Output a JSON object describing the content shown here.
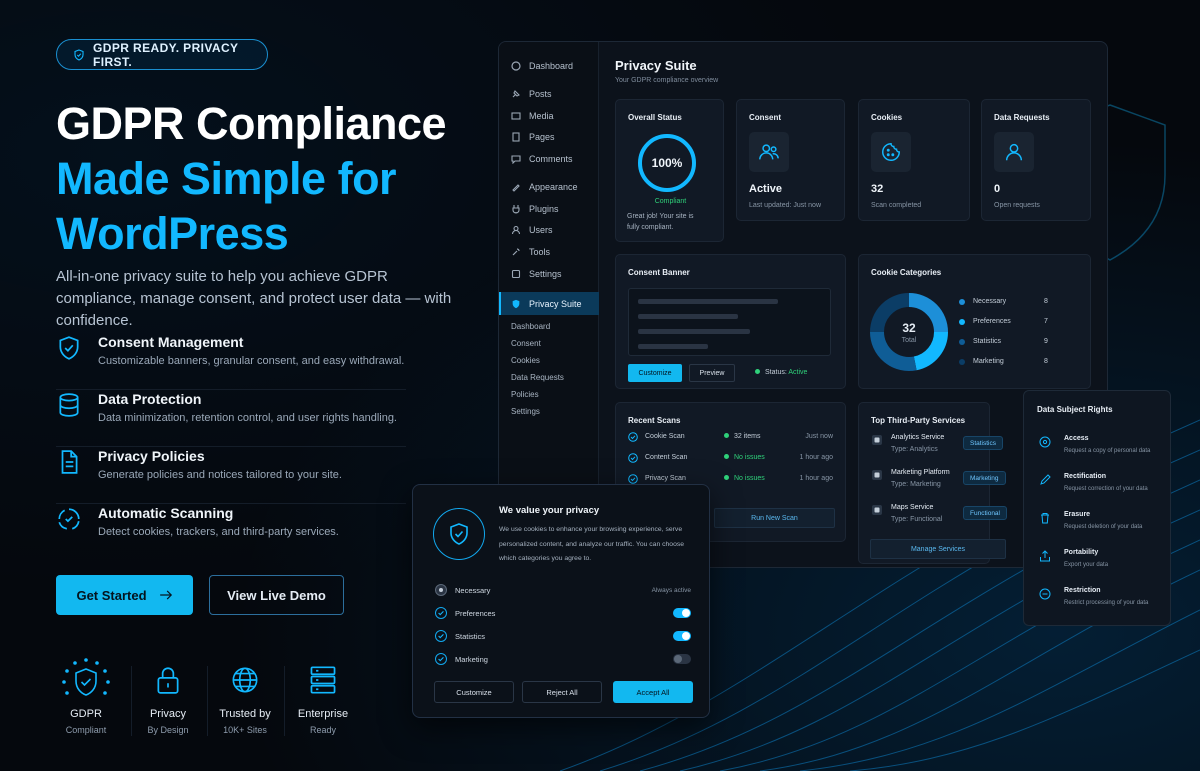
{
  "hero": {
    "badge": "GDPR READY. PRIVACY FIRST.",
    "title_line1": "GDPR Compliance",
    "title_line2": "Made Simple for",
    "title_line3": "WordPress",
    "lead": "All-in-one privacy suite to help you achieve GDPR compliance, manage consent, and protect user data — with confidence.",
    "features": [
      {
        "title": "Consent Management",
        "desc": "Customizable banners, granular consent, and easy withdrawal."
      },
      {
        "title": "Data Protection",
        "desc": "Data minimization, retention control, and user rights handling."
      },
      {
        "title": "Privacy Policies",
        "desc": "Generate policies and notices tailored to your site."
      },
      {
        "title": "Automatic Scanning",
        "desc": "Detect cookies, trackers, and third-party services."
      }
    ],
    "cta_primary": "Get Started",
    "cta_secondary": "View Live Demo",
    "badges": [
      {
        "l1": "GDPR",
        "l2": "Compliant"
      },
      {
        "l1": "Privacy",
        "l2": "By Design"
      },
      {
        "l1": "Trusted by",
        "l2": "10K+ Sites"
      },
      {
        "l1": "Enterprise",
        "l2": "Ready"
      }
    ]
  },
  "sidebar": {
    "items": [
      "Dashboard",
      "Posts",
      "Media",
      "Pages",
      "Comments",
      "Appearance",
      "Plugins",
      "Users",
      "Tools",
      "Settings"
    ],
    "active": "Privacy Suite",
    "sub": [
      "Dashboard",
      "Consent",
      "Cookies",
      "Data Requests",
      "Policies",
      "Settings"
    ]
  },
  "dashboard": {
    "title": "Privacy Suite",
    "subtitle": "Your GDPR compliance overview",
    "overall": {
      "title": "Overall Status",
      "percent": "100%",
      "percent_value": 100,
      "status": "Compliant",
      "note": "Great job! Your site is fully compliant."
    },
    "consent": {
      "title": "Consent",
      "value": "Active",
      "note": "Last updated: Just now"
    },
    "cookies": {
      "title": "Cookies",
      "value": "32",
      "note": "Scan completed"
    },
    "requests": {
      "title": "Data Requests",
      "value": "0",
      "note": "Open requests"
    },
    "banner": {
      "title": "Consent Banner",
      "customize": "Customize",
      "preview": "Preview",
      "status_label": "Status:",
      "status_value": "Active"
    },
    "categories": {
      "title": "Cookie Categories",
      "total": "32",
      "total_label": "Total",
      "items": [
        {
          "name": "Necessary",
          "count": "8",
          "value": 8,
          "color": "#1d8fd8"
        },
        {
          "name": "Preferences",
          "count": "7",
          "value": 7,
          "color": "#12b8ff"
        },
        {
          "name": "Statistics",
          "count": "9",
          "value": 9,
          "color": "#0f5d96"
        },
        {
          "name": "Marketing",
          "count": "8",
          "value": 8,
          "color": "#0b3d66"
        }
      ]
    },
    "scans": {
      "title": "Recent Scans",
      "rows": [
        {
          "name": "Cookie Scan",
          "result": "32 items",
          "time": "Just now"
        },
        {
          "name": "Content Scan",
          "result": "No issues",
          "time": "1 hour ago"
        },
        {
          "name": "Privacy Scan",
          "result": "No issues",
          "time": "1 hour ago"
        }
      ],
      "button": "Run New Scan"
    },
    "services": {
      "title": "Top Third-Party Services",
      "rows": [
        {
          "name": "Analytics Service",
          "type": "Type: Analytics",
          "tag": "Statistics"
        },
        {
          "name": "Marketing Platform",
          "type": "Type: Marketing",
          "tag": "Marketing"
        },
        {
          "name": "Maps Service",
          "type": "Type: Functional",
          "tag": "Functional"
        }
      ],
      "button": "Manage Services"
    }
  },
  "rights": {
    "title": "Data Subject Rights",
    "items": [
      {
        "title": "Access",
        "desc": "Request a copy of personal data"
      },
      {
        "title": "Rectification",
        "desc": "Request correction of your data"
      },
      {
        "title": "Erasure",
        "desc": "Request deletion of your data"
      },
      {
        "title": "Portability",
        "desc": "Export your data"
      },
      {
        "title": "Restriction",
        "desc": "Restrict processing of your data"
      }
    ]
  },
  "popup": {
    "title": "We value your privacy",
    "desc": "We use cookies to enhance your browsing experience, serve personalized content, and analyze our traffic. You can choose which categories you agree to.",
    "rows": [
      {
        "name": "Necessary",
        "state": "Always active",
        "on": null
      },
      {
        "name": "Preferences",
        "state": "",
        "on": true
      },
      {
        "name": "Statistics",
        "state": "",
        "on": true
      },
      {
        "name": "Marketing",
        "state": "",
        "on": false
      }
    ],
    "customize": "Customize",
    "reject": "Reject All",
    "accept": "Accept All"
  },
  "colors": {
    "accent": "#12b8ff",
    "bg": "#05080d",
    "green": "#2fd17a"
  }
}
